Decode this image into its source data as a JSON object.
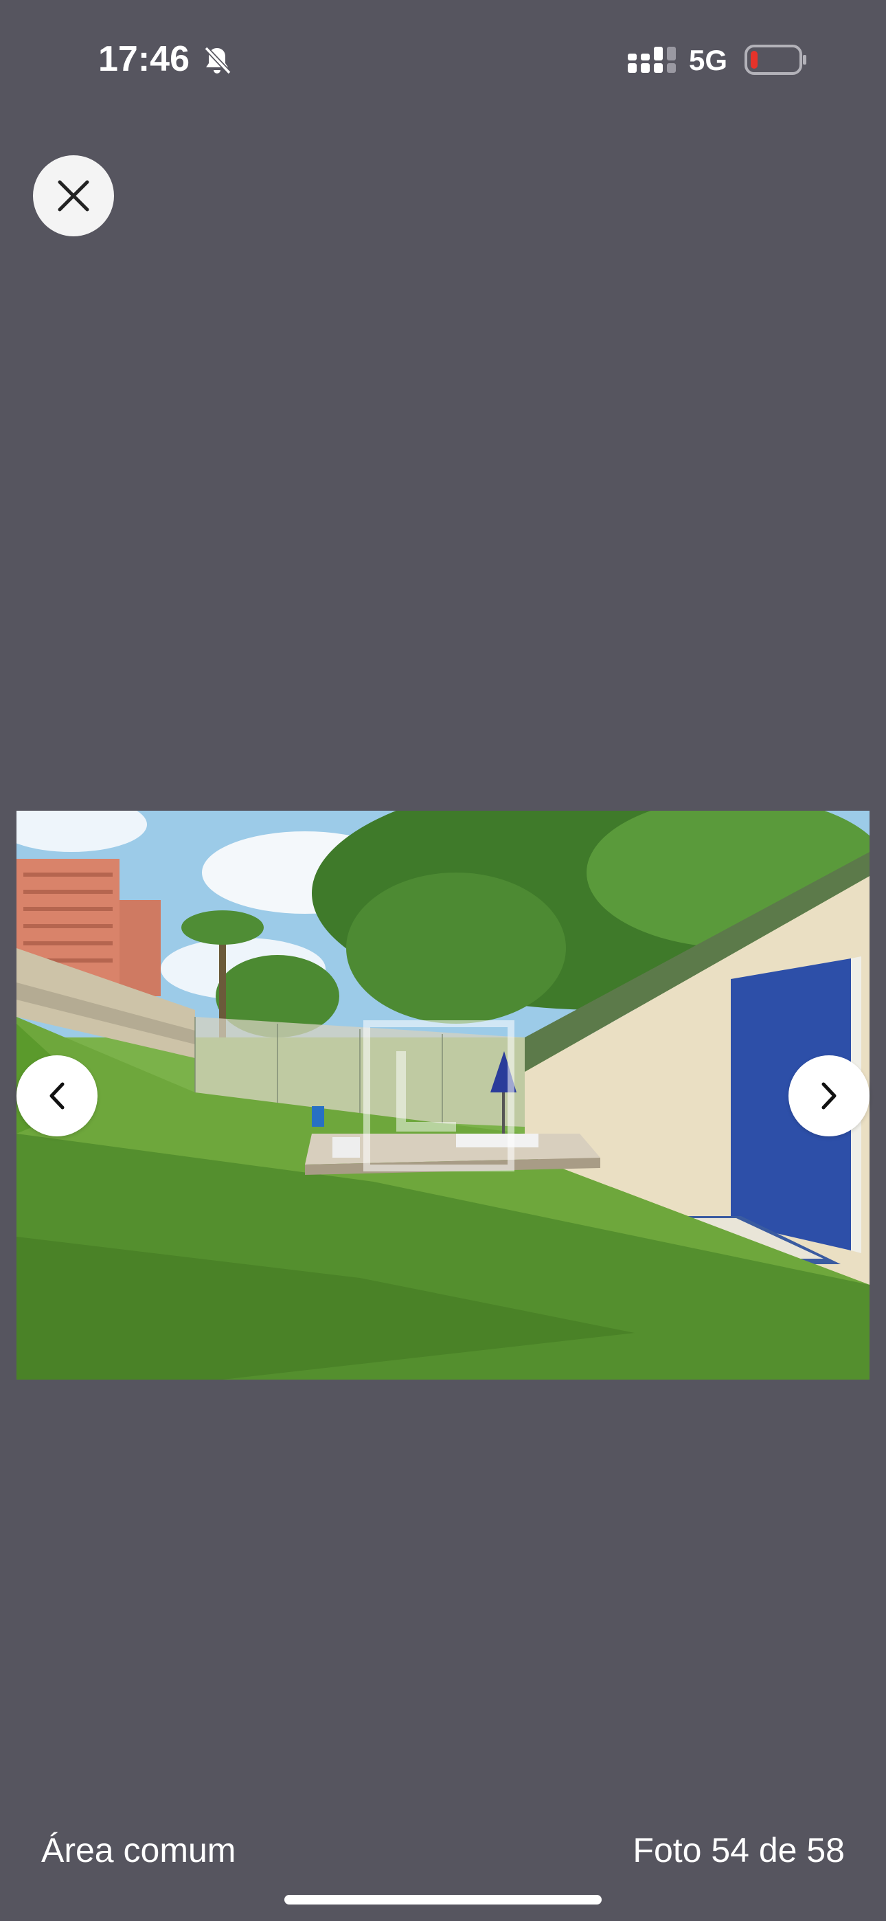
{
  "status_bar": {
    "time": "17:46",
    "network": "5G",
    "icons": [
      "bell-slash-icon",
      "signal-icon",
      "battery-low-icon"
    ],
    "battery_color": "#e5332a"
  },
  "viewer": {
    "close_icon": "close-icon",
    "prev_icon": "chevron-left-icon",
    "next_icon": "chevron-right-icon",
    "photo_description_icon": "photo",
    "caption": "Área comum",
    "counter": "Foto 54 de 58"
  },
  "colors": {
    "background": "#56555f",
    "button": "#ffffff"
  }
}
